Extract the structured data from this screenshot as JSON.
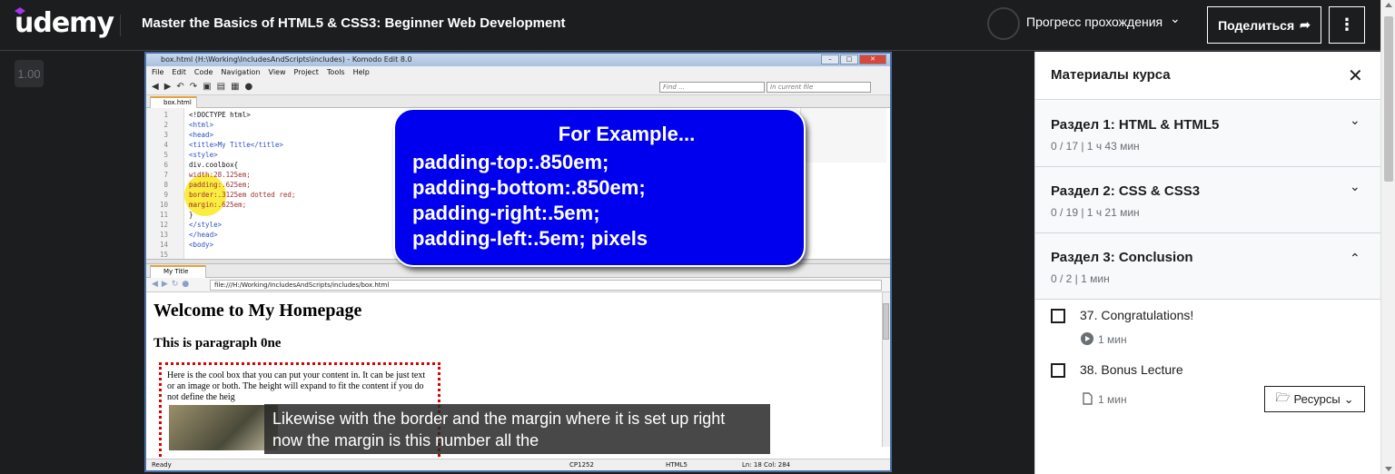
{
  "header": {
    "logo": "udemy",
    "course_title": "Master the Basics of HTML5 & CSS3: Beginner Web Development",
    "progress_label": "Прогресс прохождения",
    "share_label": "Поделиться"
  },
  "player": {
    "speed": "1.00",
    "caption_line1": "Likewise with the border and the margin where it is set up right",
    "caption_line2": "now the margin is this number all the"
  },
  "komodo": {
    "window_title": "box.html (H:\\Working\\IncludesAndScripts\\includes) - Komodo Edit 8.0",
    "menu": [
      "File",
      "Edit",
      "Code",
      "Navigation",
      "View",
      "Project",
      "Tools",
      "Help"
    ],
    "find_placeholder": "Find ...",
    "scope_placeholder": "In current file",
    "editor_tab": "box.html",
    "code_lines": [
      {
        "n": "1",
        "t": "<!DOCTYPE html>"
      },
      {
        "n": "2",
        "t": "<html>"
      },
      {
        "n": "3",
        "t": "<head>"
      },
      {
        "n": "4",
        "t": "<title>My Title</title>"
      },
      {
        "n": "5",
        "t": "<style>"
      },
      {
        "n": "6",
        "t": "div.coolbox{"
      },
      {
        "n": "7",
        "t": "width:28.125em;"
      },
      {
        "n": "8",
        "t": "padding:.625em;"
      },
      {
        "n": "9",
        "t": "border:.3125em dotted red;"
      },
      {
        "n": "10",
        "t": "margin:.625em;"
      },
      {
        "n": "11",
        "t": "}"
      },
      {
        "n": "12",
        "t": "</style>"
      },
      {
        "n": "13",
        "t": "</head>"
      },
      {
        "n": "14",
        "t": "<body>"
      },
      {
        "n": "15",
        "t": ""
      }
    ],
    "browser_tab": "My Title",
    "url": "file:///H:/Working/IncludesAndScripts/includes/box.html",
    "page_h1": "Welcome to My Homepage",
    "page_h3": "This is paragraph 0ne",
    "coolbox_text": "Here is the cool box that you can put your content in. It can be just text or an image or both. The height will expand to fit the content if you do not define the heig",
    "status_ready": "Ready",
    "status_encoding": "CP1252",
    "status_lang": "HTML5",
    "status_pos": "Ln: 18 Col: 284"
  },
  "callout": {
    "title": "For Example...",
    "lines": [
      "padding-top:.850em;",
      "padding-bottom:.850em;",
      "padding-right:.5em;",
      "padding-left:.5em; pixels"
    ]
  },
  "sidebar": {
    "title": "Материалы курса",
    "sections": [
      {
        "title": "Раздел 1: HTML & HTML5",
        "meta": "0 / 17 | 1 ч 43 мин"
      },
      {
        "title": "Раздел 2: CSS & CSS3",
        "meta": "0 / 19 | 1 ч 21 мин"
      },
      {
        "title": "Раздел 3: Conclusion",
        "meta": "0 / 2 | 1 мин"
      }
    ],
    "lectures": [
      {
        "title": "37. Congratulations!",
        "duration": "1 мин",
        "icon": "play-icon"
      },
      {
        "title": "38. Bonus Lecture",
        "duration": "1 мин",
        "icon": "file-icon"
      }
    ],
    "resources_label": "Ресурсы"
  },
  "colors": {
    "brand": "#a435f0",
    "callout_bg": "#0000ee",
    "header_bg": "#1c1d1f"
  }
}
